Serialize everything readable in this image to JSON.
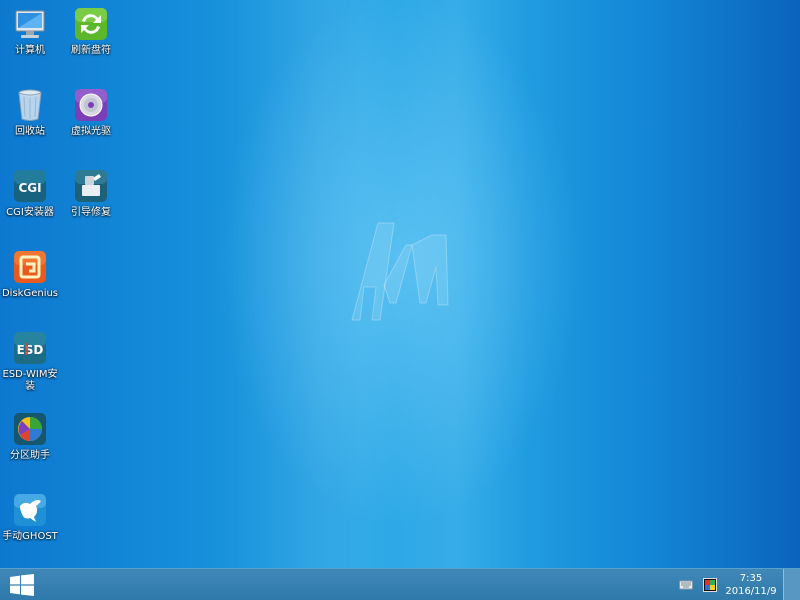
{
  "desktop": {
    "icons": [
      {
        "id": "computer",
        "label": "计算机",
        "icon": "computer-icon"
      },
      {
        "id": "refresh",
        "label": "刷新盘符",
        "icon": "refresh-drives-icon"
      },
      {
        "id": "recycle",
        "label": "回收站",
        "icon": "recycle-bin-icon"
      },
      {
        "id": "virtual-drive",
        "label": "虚拟光驱",
        "icon": "virtual-drive-icon"
      },
      {
        "id": "cgi",
        "label": "CGI安装器",
        "icon": "cgi-installer-icon",
        "badge": "CGI"
      },
      {
        "id": "boot-repair",
        "label": "引导修复",
        "icon": "boot-repair-icon"
      },
      {
        "id": "diskgenius",
        "label": "DiskGenius",
        "icon": "diskgenius-icon"
      },
      {
        "id": "esd",
        "label": "ESD-WIM安装",
        "icon": "esd-wim-installer-icon",
        "badge": "ESD"
      },
      {
        "id": "partition",
        "label": "分区助手",
        "icon": "partition-assistant-icon"
      },
      {
        "id": "ghost",
        "label": "手动GHOST",
        "icon": "ghost-icon"
      }
    ]
  },
  "taskbar": {
    "start_icon": "windows-logo-icon",
    "tray": [
      {
        "id": "keyboard",
        "icon": "keyboard-icon"
      },
      {
        "id": "display",
        "icon": "display-color-icon"
      }
    ],
    "clock": {
      "time": "7:35",
      "date": "2016/11/9"
    }
  },
  "colors": {
    "desktop_accent": "#1e9be0",
    "taskbar": "#3a84b5"
  }
}
